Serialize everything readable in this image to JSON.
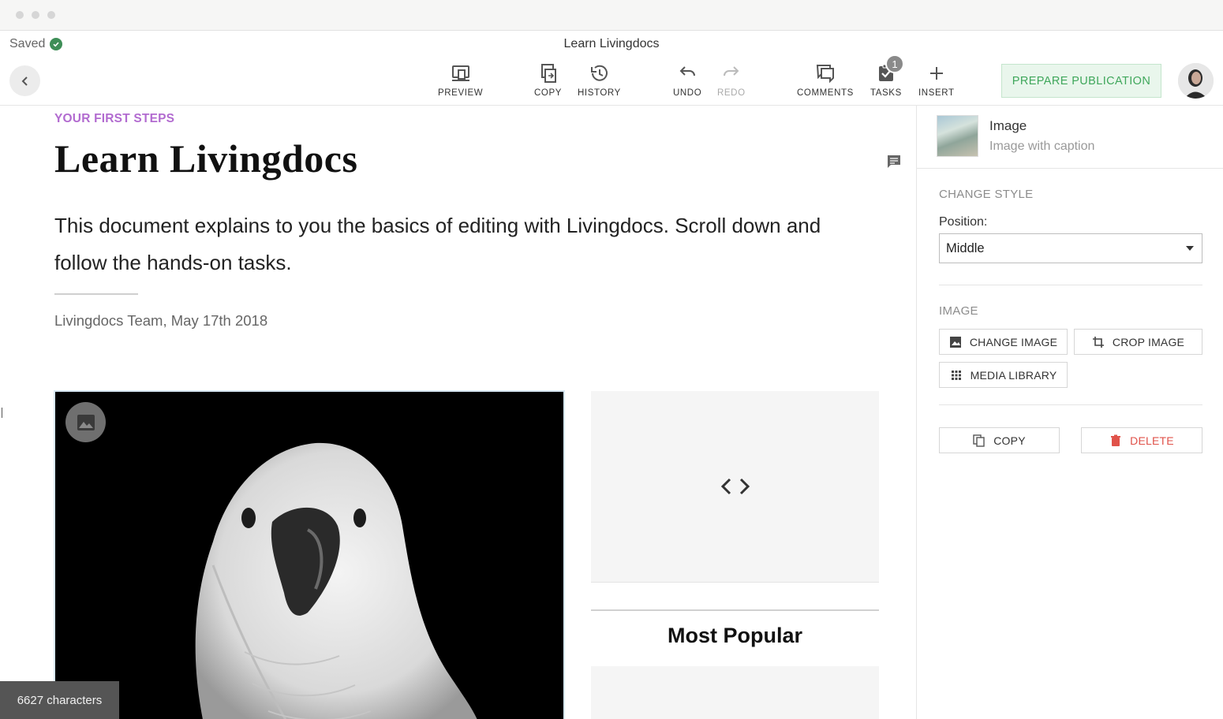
{
  "window": {
    "dots": 3
  },
  "header": {
    "saved_label": "Saved",
    "document_title": "Learn Livingdocs",
    "toolbar": {
      "preview": "PREVIEW",
      "copy": "COPY",
      "history": "HISTORY",
      "undo": "UNDO",
      "redo": "REDO",
      "comments": "COMMENTS",
      "tasks": "TASKS",
      "tasks_badge": "1",
      "insert": "INSERT"
    },
    "publish_label": "PREPARE PUBLICATION"
  },
  "document": {
    "kicker": "YOUR FIRST STEPS",
    "title": "Learn Livingdocs",
    "lead": "This document explains to you the basics of editing with Livingdocs. Scroll down and follow the hands-on tasks.",
    "byline": "Livingdocs Team, May 17th 2018",
    "most_popular": "Most Popular",
    "char_count": "6627 characters"
  },
  "sidebar": {
    "selected": {
      "title": "Image",
      "subtitle": "Image with caption"
    },
    "change_style_label": "CHANGE STYLE",
    "position_label": "Position:",
    "position_value": "Middle",
    "image_section_label": "IMAGE",
    "buttons": {
      "change_image": "CHANGE IMAGE",
      "crop_image": "CROP IMAGE",
      "media_library": "MEDIA LIBRARY",
      "copy": "COPY",
      "delete": "DELETE"
    }
  },
  "colors": {
    "kicker": "#b26bd0",
    "publish_text": "#3fa75b",
    "publish_bg": "#e9f6ec",
    "saved_check": "#3e8e57",
    "delete": "#e0524a"
  },
  "icons": [
    "check-icon",
    "chevron-left-icon",
    "preview-icon",
    "copy-icon",
    "history-icon",
    "undo-icon",
    "redo-icon",
    "comments-icon",
    "tasks-icon",
    "plus-icon",
    "comment-icon",
    "image-icon",
    "code-icon",
    "crop-icon",
    "grid-icon",
    "trash-icon",
    "caret-down-icon"
  ]
}
